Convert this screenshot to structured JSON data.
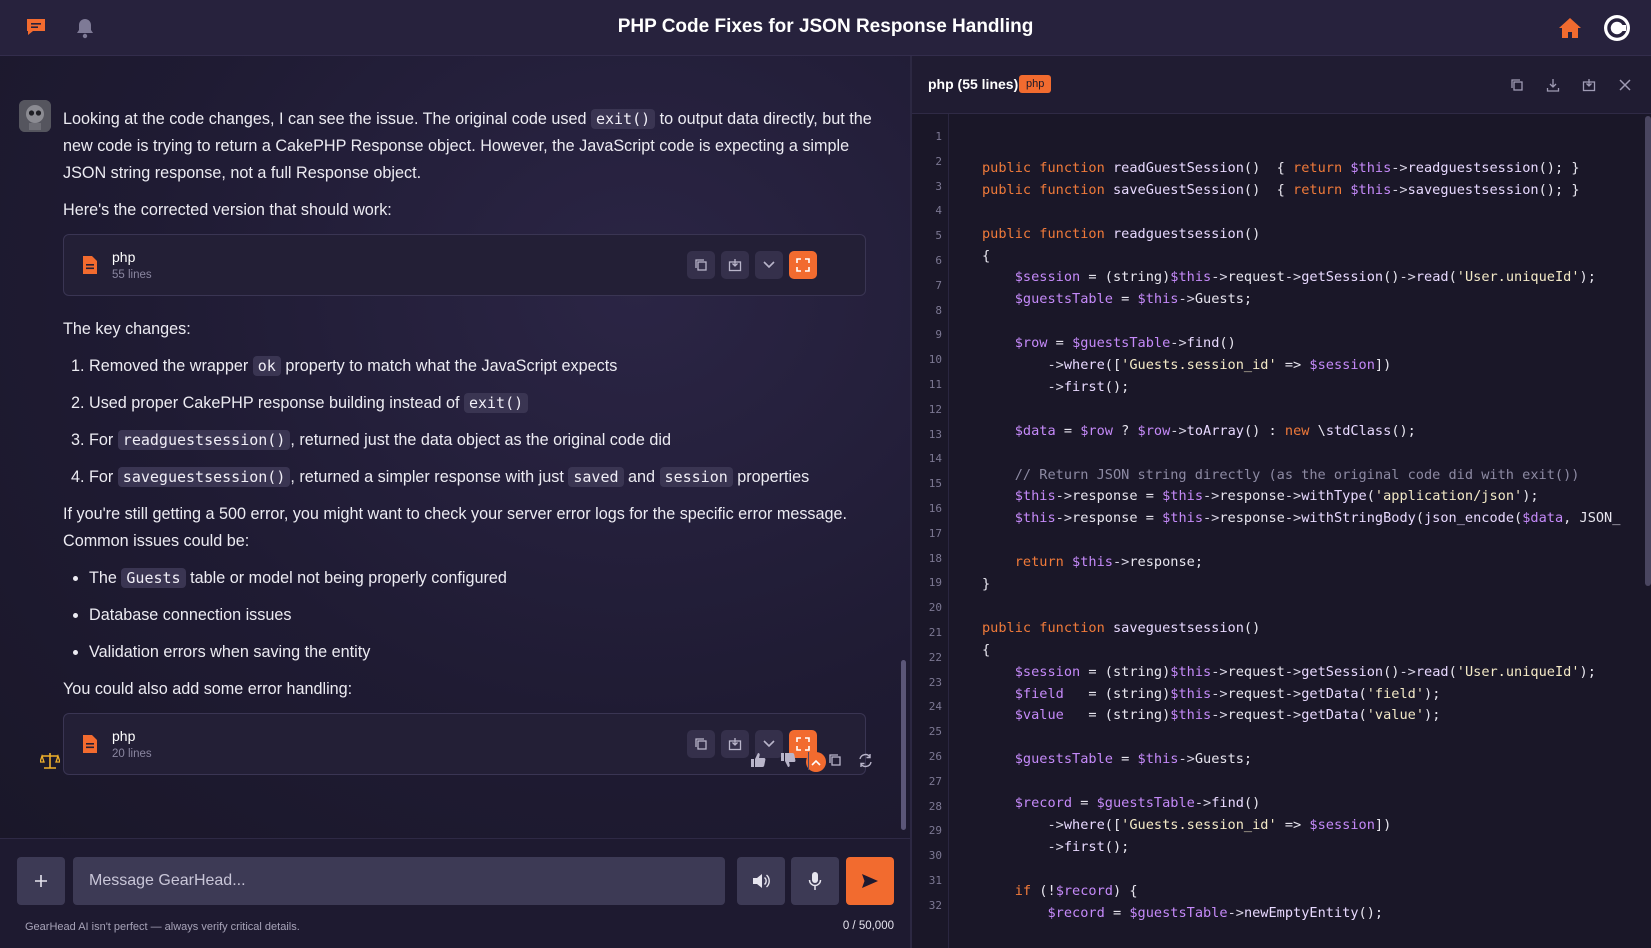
{
  "header": {
    "title": "PHP Code Fixes for JSON Response Handling",
    "icons": [
      "chat-icon",
      "bell-icon",
      "home-icon",
      "brand-logo-icon"
    ],
    "accent": "#f26b2f"
  },
  "message": {
    "intro_1": "Looking at the code changes, I can see the issue. The original code used ",
    "intro_code": "exit()",
    "intro_2": " to output data directly, but the new code is trying to return a CakePHP Response object. However, the JavaScript code is expecting a simple JSON string response, not a full Response object.",
    "corrected": "Here's the corrected version that should work:",
    "card1": {
      "lang": "php",
      "lines": "55 lines"
    },
    "key_changes": "The key changes:",
    "changes": [
      {
        "n": "1.",
        "a": " Removed the wrapper ",
        "c1": "ok",
        "b": " property to match what the JavaScript expects"
      },
      {
        "n": "2.",
        "a": " Used proper CakePHP response building instead of ",
        "c1": "exit()"
      },
      {
        "n": "3.",
        "a": " For ",
        "c1": "readguestsession()",
        "b": ", returned just the data object as the original code did"
      },
      {
        "n": "4.",
        "a": " For ",
        "c1": "saveguestsession()",
        "b": ", returned a simpler response with just ",
        "c2": "saved",
        "d": " and ",
        "c3": "session",
        "e": " properties"
      }
    ],
    "error_note": "If you're still getting a 500 error, you might want to check your server error logs for the specific error message. Common issues could be:",
    "issues": [
      {
        "a": "The ",
        "c": "Guests",
        "b": " table or model not being properly configured"
      },
      {
        "a": "Database connection issues"
      },
      {
        "a": "Validation errors when saving the entity"
      }
    ],
    "error_handling": "You could also add some error handling:",
    "card2": {
      "lang": "php",
      "lines": "20 lines"
    }
  },
  "composer": {
    "placeholder": "Message GearHead...",
    "disclaimer": "GearHead AI isn't perfect — always verify critical details.",
    "counter": "0 / 50,000"
  },
  "editor": {
    "title": "php (55 lines)",
    "badge": "php",
    "line_numbers": [
      "1",
      "2",
      "3",
      "4",
      "5",
      "6",
      "7",
      "8",
      "9",
      "10",
      "11",
      "12",
      "13",
      "14",
      "15",
      "16",
      "17",
      "18",
      "19",
      "20",
      "21",
      "22",
      "23",
      "24",
      "25",
      "26",
      "27",
      "28",
      "29",
      "30",
      "31",
      "32"
    ],
    "code_lines": [
      "",
      "public function readGuestSession()  { return $this->readguestsession(); }",
      "public function saveGuestSession()  { return $this->saveguestsession(); }",
      "",
      "public function readguestsession()",
      "{",
      "    $session = (string)$this->request->getSession()->read('User.uniqueId');",
      "    $guestsTable = $this->Guests;",
      "",
      "    $row = $guestsTable->find()",
      "        ->where(['Guests.session_id' => $session])",
      "        ->first();",
      "",
      "    $data = $row ? $row->toArray() : new \\stdClass();",
      "",
      "    // Return JSON string directly (as the original code did with exit())",
      "    $this->response = $this->response->withType('application/json');",
      "    $this->response = $this->response->withStringBody(json_encode($data, JSON_",
      "",
      "    return $this->response;",
      "}",
      "",
      "public function saveguestsession()",
      "{",
      "    $session = (string)$this->request->getSession()->read('User.uniqueId');",
      "    $field   = (string)$this->request->getData('field');",
      "    $value   = (string)$this->request->getData('value');",
      "",
      "    $guestsTable = $this->Guests;",
      "",
      "    $record = $guestsTable->find()",
      "        ->where(['Guests.session_id' => $session])",
      "        ->first();",
      "",
      "    if (!$record) {",
      "        $record = $guestsTable->newEmptyEntity();"
    ]
  }
}
